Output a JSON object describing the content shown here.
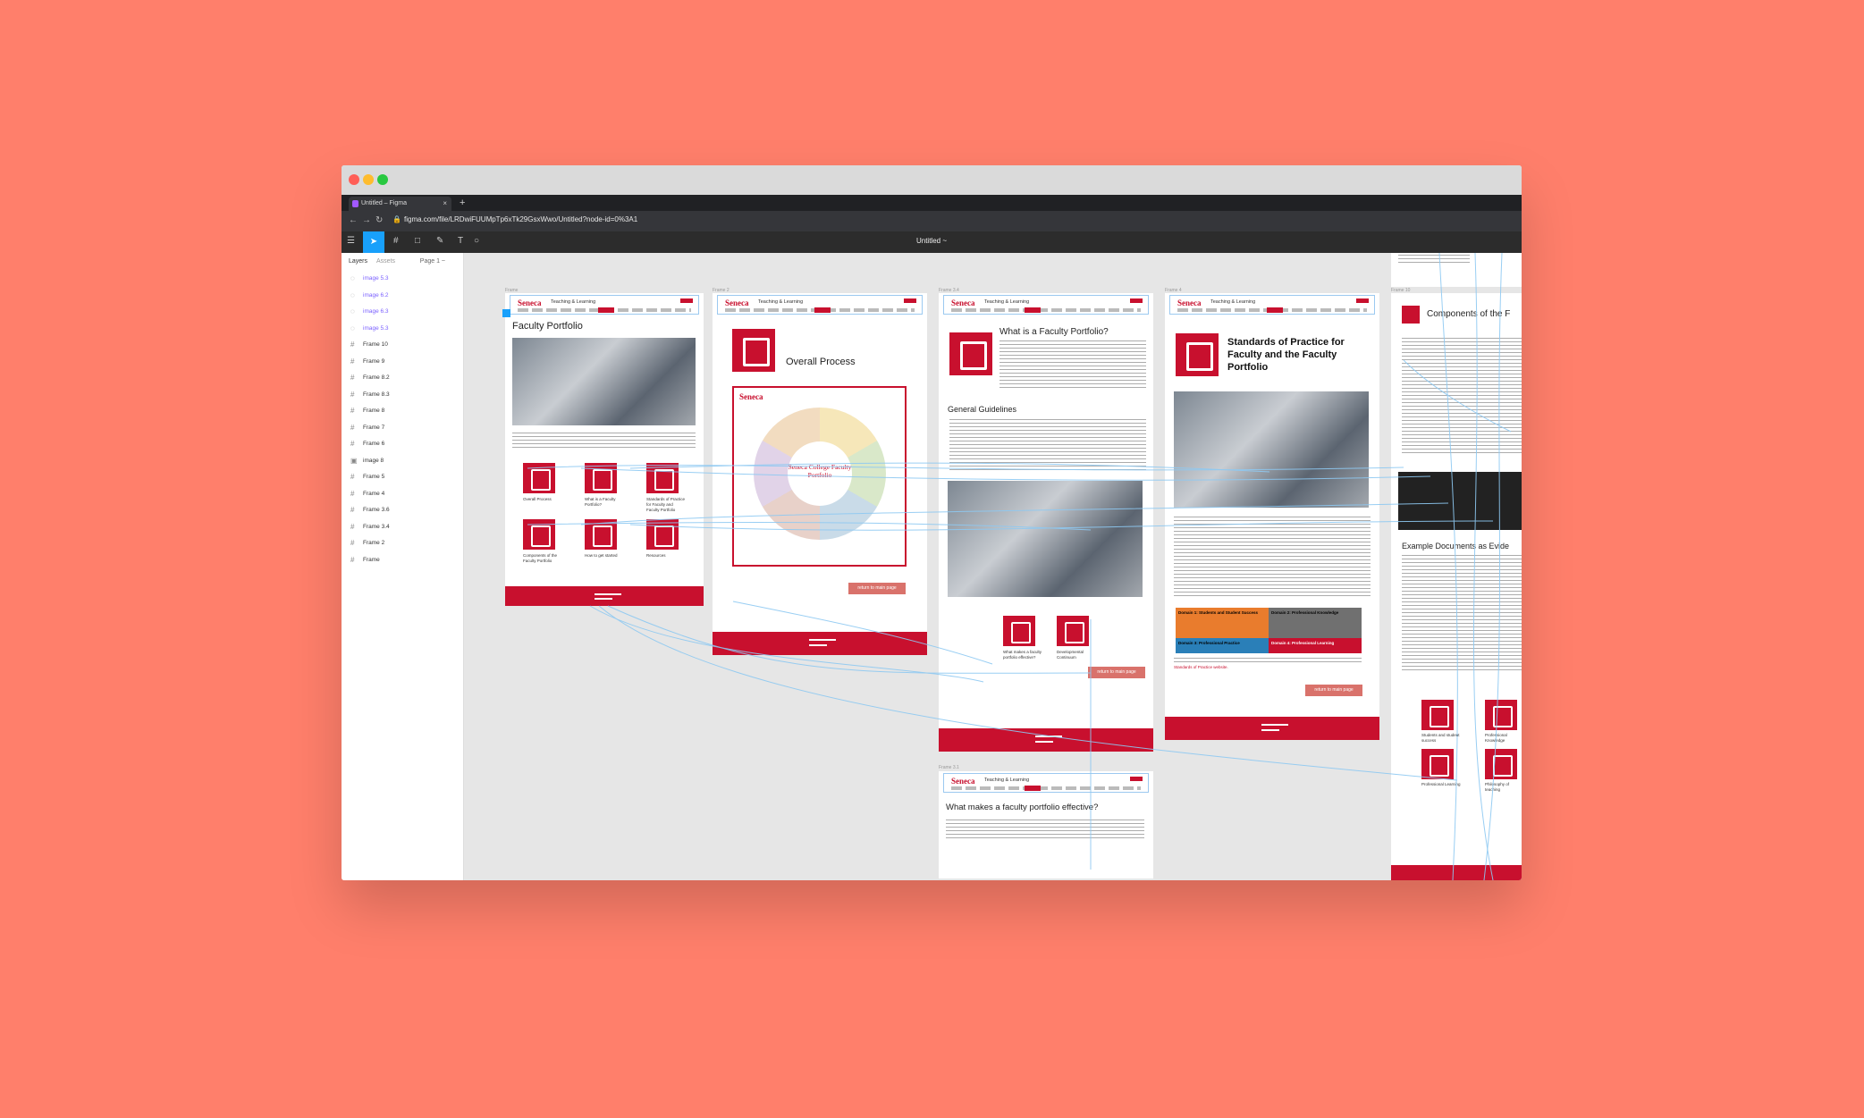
{
  "browser": {
    "tab_title": "Untitled – Figma",
    "new_tab": "+",
    "url": "figma.com/file/LRDwiFUUMpTp6xTk29GsxWwo/Untitled?node-id=0%3A1"
  },
  "figma": {
    "doc_title": "Untitled ~",
    "layers_tab": "Layers",
    "assets_tab": "Assets",
    "page": "Page 1 ~"
  },
  "layers": [
    {
      "name": "image 5.3",
      "type": "image"
    },
    {
      "name": "image 6.2",
      "type": "image"
    },
    {
      "name": "image 6.3",
      "type": "image"
    },
    {
      "name": "image 5.3",
      "type": "image"
    },
    {
      "name": "Frame 10",
      "type": "frame"
    },
    {
      "name": "Frame 9",
      "type": "frame"
    },
    {
      "name": "Frame 8.2",
      "type": "frame"
    },
    {
      "name": "Frame 8.3",
      "type": "frame"
    },
    {
      "name": "Frame 8",
      "type": "frame"
    },
    {
      "name": "Frame 7",
      "type": "frame"
    },
    {
      "name": "Frame 6",
      "type": "frame"
    },
    {
      "name": "image 8",
      "type": "image2"
    },
    {
      "name": "Frame 5",
      "type": "frame"
    },
    {
      "name": "Frame 4",
      "type": "frame"
    },
    {
      "name": "Frame 3.6",
      "type": "frame"
    },
    {
      "name": "Frame 3.4",
      "type": "frame"
    },
    {
      "name": "Frame 2",
      "type": "frame"
    },
    {
      "name": "Frame",
      "type": "frame"
    }
  ],
  "site": {
    "logo": "Seneca",
    "title": "Teaching & Learning",
    "return_btn": "return to main page"
  },
  "frames": {
    "f1": {
      "label": "Frame",
      "heading": "Faculty Portfolio",
      "icons": [
        "Overall Process",
        "What is a Faculty Portfolio?",
        "Standards of Practice for Faculty and Faculty Portfolio",
        "Components of the Faculty Portfolio",
        "How to get started",
        "Resources"
      ]
    },
    "f2": {
      "label": "Frame 2",
      "heading": "Overall Process",
      "wheel_logo": "Seneca",
      "wheel_center": "Seneca College Faculty Portfolio"
    },
    "f3": {
      "label": "Frame 3.4",
      "heading": "What is a Faculty Portfolio?",
      "sub": "General Guidelines",
      "icons": [
        "What makes a faculty portfolio effective?",
        "Developmental Continuum"
      ]
    },
    "f4": {
      "label": "Frame 4",
      "heading": "Standards of Practice for Faculty and the Faculty Portfolio",
      "domains": [
        "Domain 1: Students and Student Success",
        "Domain 2: Professional Knowledge",
        "Domain 3: Professional Practice",
        "Domain 4: Professional Learning"
      ],
      "link": "Standards of Practice website."
    },
    "f5": {
      "label": "Frame 3.1",
      "heading": "What makes a faculty portfolio effective?"
    },
    "f6": {
      "label": "Frame 10",
      "heading": "Components of the F",
      "sub": "Example Documents as Evide",
      "icons": [
        "Students and student success",
        "Professional Knowledge",
        "Professional Learning",
        "Philosophy of teaching"
      ]
    }
  },
  "colors": {
    "accent": "#c8102e",
    "figma_blue": "#18a0fb",
    "backdrop": "#ff7f6b"
  }
}
